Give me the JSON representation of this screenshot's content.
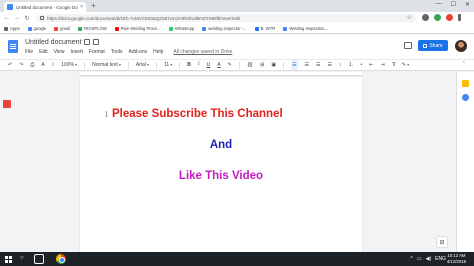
{
  "browser": {
    "tab_title": "Untitled document - Google Do",
    "tab_close": "×",
    "new_tab": "+",
    "window_controls": [
      "—",
      "☐",
      "✕"
    ],
    "url": "https://docs.google.com/document/d/1Eh-7uMVC5S0aQ2S87vmiJA5lGkVd9mOTMMfbiVeeIr/edit",
    "bookmarks": [
      {
        "label": "Apps",
        "color": "#5f6368"
      },
      {
        "label": "google",
        "color": "#4285f4"
      },
      {
        "label": "gmail",
        "color": "#ea4335"
      },
      {
        "label": "RIGSPLOW",
        "color": "#34a853"
      },
      {
        "label": "Pipe Welding Proce...",
        "color": "#ff0000"
      },
      {
        "label": "WhatsApp",
        "color": "#25d366"
      },
      {
        "label": "welding inspector -...",
        "color": "#4285f4"
      },
      {
        "label": "B. WTR",
        "color": "#1a73e8"
      },
      {
        "label": "Welding Inspection...",
        "color": "#4285f4"
      }
    ]
  },
  "docs": {
    "title": "Untitled document",
    "menu": [
      "File",
      "Edit",
      "View",
      "Insert",
      "Format",
      "Tools",
      "Add-ons",
      "Help"
    ],
    "save_status": "All changes saved in Drive",
    "share_label": "Share"
  },
  "toolbar": {
    "undo": "↶",
    "redo": "↷",
    "print": "⎙",
    "spell": "A",
    "paint": "⌇",
    "zoom": "100%",
    "style": "Normal text",
    "font": "Arial",
    "size": "11",
    "bold": "B",
    "italic": "I",
    "underline": "U",
    "text_color": "A",
    "highlight": "✎",
    "link": "⛓",
    "comment": "⊞",
    "image": "▣",
    "align_left": "☰",
    "align_center": "☰",
    "align_right": "☰",
    "justify": "☰",
    "line_spacing": "↕",
    "numbered_list": "⒈",
    "bulleted_list": "•",
    "decrease_indent": "⇤",
    "increase_indent": "⇥",
    "clear_format": "T̸",
    "edit_mode": "✎",
    "collapse": "⌃"
  },
  "document": {
    "line1": "Please Subscribe This Channel",
    "line2": "And",
    "line3": "Like This Video",
    "cursor": "I"
  },
  "taskbar": {
    "search_icon": "○",
    "time": "10:12 AM",
    "date": "4/12/2019",
    "tray": [
      "^",
      "▭",
      "◀)",
      "ENG"
    ]
  },
  "colors": {
    "line1": "#e2211c",
    "line2": "#1f1fb3",
    "line3": "#c21cc2",
    "accent": "#1a73e8"
  }
}
